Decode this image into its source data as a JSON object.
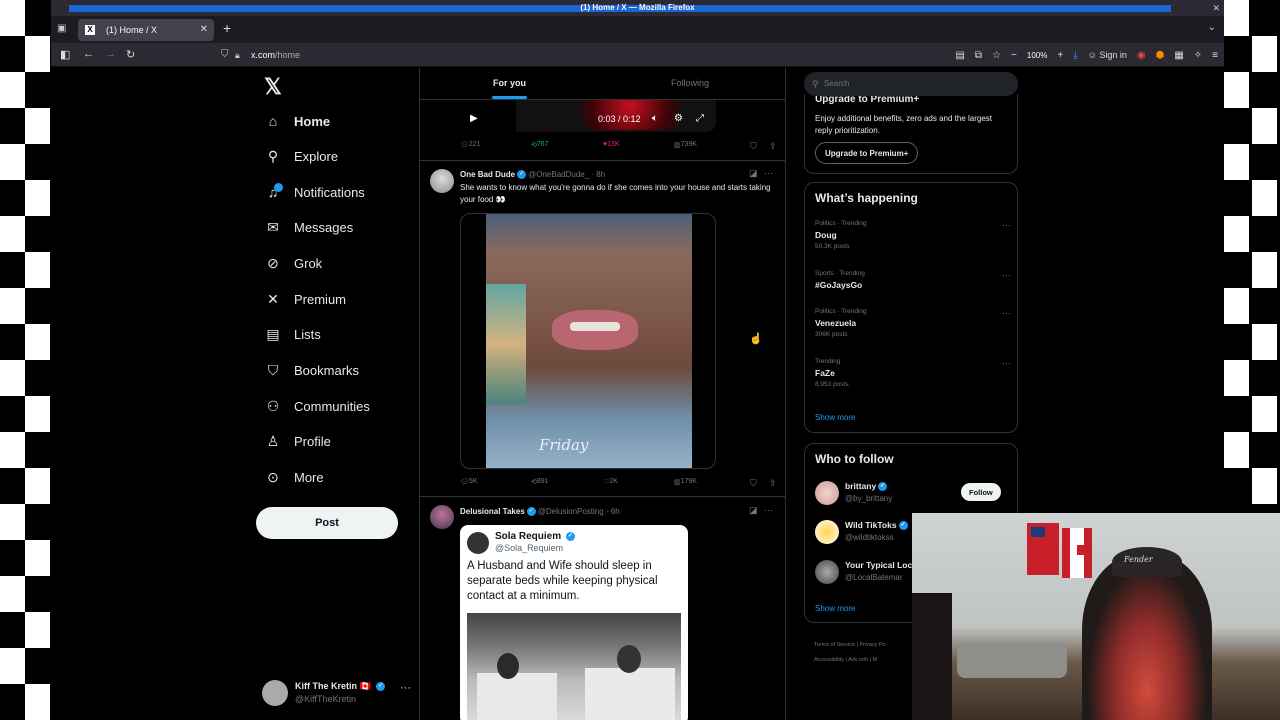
{
  "browser": {
    "window_title": "(1) Home / X — Mozilla Firefox",
    "tab_title": "(1) Home / X",
    "url_host": "x.com",
    "url_path": "/home",
    "zoom": "100%",
    "signin": "Sign in"
  },
  "sidebar": {
    "items": [
      {
        "label": "Home",
        "icon": "home-icon",
        "glyph": "⌂"
      },
      {
        "label": "Explore",
        "icon": "search-icon",
        "glyph": "⚲"
      },
      {
        "label": "Notifications",
        "icon": "bell-icon",
        "glyph": "🔔"
      },
      {
        "label": "Messages",
        "icon": "envelope-icon",
        "glyph": "✉"
      },
      {
        "label": "Grok",
        "icon": "grok-icon",
        "glyph": "◪"
      },
      {
        "label": "Premium",
        "icon": "x-premium-icon",
        "glyph": "𝕏"
      },
      {
        "label": "Lists",
        "icon": "list-icon",
        "glyph": "☰"
      },
      {
        "label": "Bookmarks",
        "icon": "bookmark-icon",
        "glyph": "⚑"
      },
      {
        "label": "Communities",
        "icon": "communities-icon",
        "glyph": "⚇"
      },
      {
        "label": "Profile",
        "icon": "profile-icon",
        "glyph": "♙"
      },
      {
        "label": "More",
        "icon": "more-circle-icon",
        "glyph": "⊙"
      }
    ],
    "post_label": "Post",
    "me": {
      "name": "Kiff The Kretin 🇨🇦",
      "handle": "@KiffTheKretin"
    }
  },
  "timeline": {
    "tabs": [
      "For you",
      "Following"
    ],
    "video_time": "0:03 / 0:12",
    "post1_stats": {
      "replies": "221",
      "reposts": "767",
      "likes": "13K",
      "views": "739K"
    },
    "post2": {
      "name": "One Bad Dude",
      "handle": "@OneBadDude_",
      "time": "· 8h",
      "text": "She wants to know what you're gonna do if she comes into your house and starts taking your food 👀",
      "media_caption": "Friday",
      "stats": {
        "replies": "5K",
        "reposts": "891",
        "likes": "2K",
        "views": "179K"
      }
    },
    "post3": {
      "name": "Delusional Takes",
      "handle": "@DelusionPosting",
      "time": "· 6h",
      "quote": {
        "name": "Sola Requiem",
        "handle": "@Sola_Requiem",
        "text": "A Husband and Wife should sleep in separate beds while keeping physical contact at a minimum."
      }
    }
  },
  "right": {
    "search_placeholder": "Search",
    "premium": {
      "title": "Upgrade to Premium+",
      "text": "Enjoy additional benefits, zero ads and the largest reply prioritization.",
      "button": "Upgrade to Premium+"
    },
    "trends_title": "What’s happening",
    "trends": [
      {
        "category": "Politics · Trending",
        "name": "Doug",
        "posts": "50.3K posts"
      },
      {
        "category": "Sports · Trending",
        "name": "#GoJaysGo",
        "posts": ""
      },
      {
        "category": "Politics · Trending",
        "name": "Venezuela",
        "posts": "306K posts"
      },
      {
        "category": "Trending",
        "name": "FaZe",
        "posts": "8,953 posts"
      }
    ],
    "show_more": "Show more",
    "wtf_title": "Who to follow",
    "follow": [
      {
        "name": "brittany",
        "handle": "@by_brittany",
        "button": "Follow"
      },
      {
        "name": "Wild TikToks",
        "handle": "@wildtiktokss",
        "button": ""
      },
      {
        "name": "Your Typical Loc",
        "handle": "@LocalBatemar",
        "button": ""
      }
    ],
    "footer_1": "Terms of Service  |  Privacy Po",
    "footer_2": "Accessibility  |  Ads info  |  M"
  },
  "webcam": {
    "cap_text": "Fender"
  },
  "colors": {
    "accent": "#1d9bf0",
    "like": "#f91880",
    "repost": "#00ba7c",
    "background": "#000000"
  }
}
